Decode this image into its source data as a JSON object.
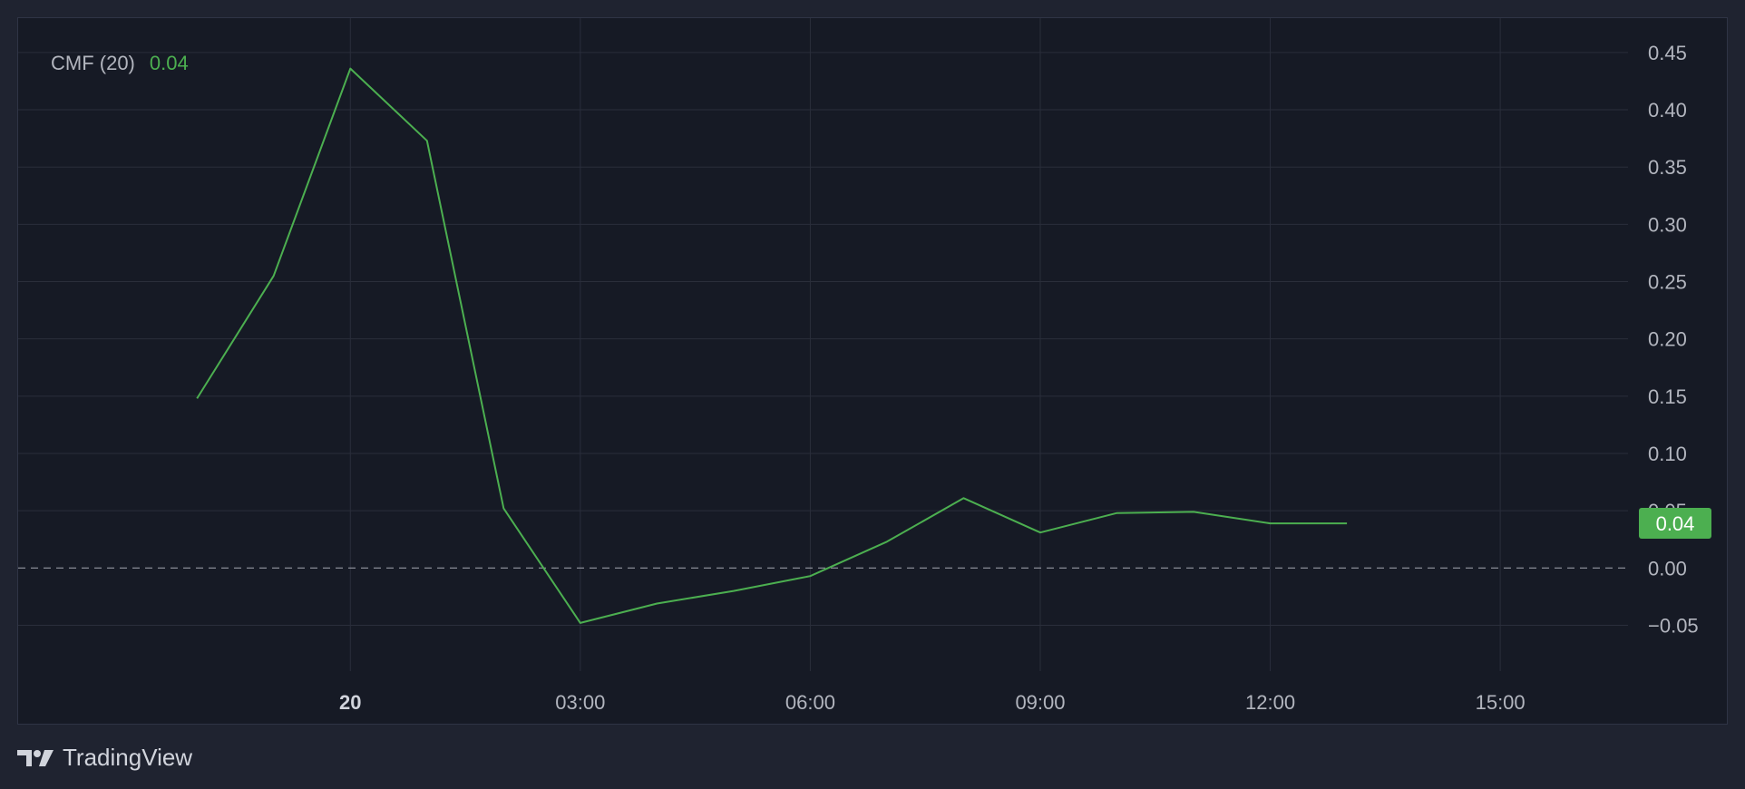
{
  "legend": {
    "indicator": "CMF (20)",
    "value": "0.04"
  },
  "brand": {
    "name": "TradingView"
  },
  "colors": {
    "background": "#1f2330",
    "panel": "#161a25",
    "grid": "#2a2e3b",
    "line": "#4caf50",
    "axis_text": "#b2b5be",
    "zero_line": "#9598a1"
  },
  "chart_data": {
    "type": "line",
    "title": "",
    "xlabel": "",
    "ylabel": "",
    "ylim": [
      -0.09,
      0.48
    ],
    "yticks": [
      -0.05,
      0.0,
      0.05,
      0.1,
      0.15,
      0.2,
      0.25,
      0.3,
      0.35,
      0.4,
      0.45
    ],
    "ytick_labels": [
      "−0.05",
      "0.00",
      "0.05",
      "0.10",
      "0.15",
      "0.20",
      "0.25",
      "0.30",
      "0.35",
      "0.40",
      "0.45"
    ],
    "xlim": [
      "19 Mar 19:40",
      "20 Mar 16:40"
    ],
    "xticks": [
      {
        "x": "20 00:00",
        "label": "20",
        "bold": true
      },
      {
        "x": "20 03:00",
        "label": "03:00",
        "bold": false
      },
      {
        "x": "20 06:00",
        "label": "06:00",
        "bold": false
      },
      {
        "x": "20 09:00",
        "label": "09:00",
        "bold": false
      },
      {
        "x": "20 12:00",
        "label": "12:00",
        "bold": false
      },
      {
        "x": "20 15:00",
        "label": "15:00",
        "bold": false
      }
    ],
    "zero_line": {
      "y": 0,
      "style": "dashed"
    },
    "grid": true,
    "series": [
      {
        "x": [
          "19 22:00",
          "19 23:00",
          "20 00:00",
          "20 01:00",
          "20 02:00",
          "20 03:00",
          "20 04:00",
          "20 05:00",
          "20 06:00",
          "20 07:00",
          "20 08:00",
          "20 09:00",
          "20 10:00",
          "20 11:00",
          "20 12:00",
          "20 13:00"
        ],
        "values": [
          0.148,
          0.255,
          0.436,
          0.373,
          0.052,
          -0.048,
          -0.031,
          -0.02,
          -0.007,
          0.023,
          0.061,
          0.031,
          0.048,
          0.049,
          0.039,
          0.039
        ]
      }
    ],
    "last_value_label": "0.04"
  }
}
